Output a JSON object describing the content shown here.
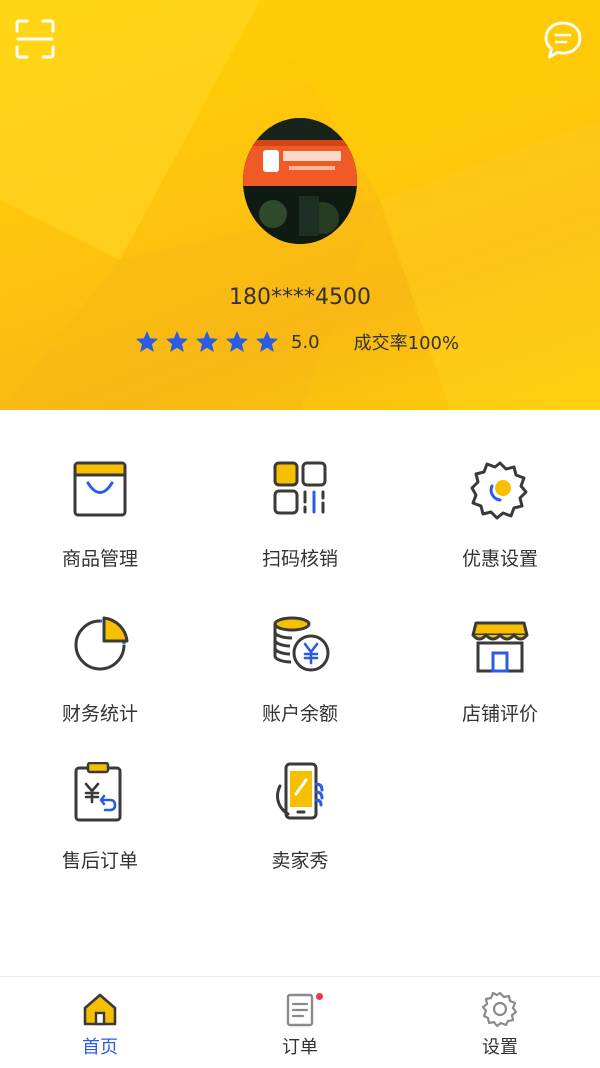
{
  "profile": {
    "phone": "180****4500",
    "rating": 5.0,
    "rating_text": "5.0",
    "deal_rate_text": "成交率100%",
    "stars": 5
  },
  "menu": [
    {
      "label": "商品管理",
      "icon": "shopping-bag-icon"
    },
    {
      "label": "扫码核销",
      "icon": "qr-scan-icon"
    },
    {
      "label": "优惠设置",
      "icon": "discount-gear-icon"
    },
    {
      "label": "财务统计",
      "icon": "pie-chart-icon"
    },
    {
      "label": "账户余额",
      "icon": "coins-yen-icon"
    },
    {
      "label": "店铺评价",
      "icon": "storefront-icon"
    },
    {
      "label": "售后订单",
      "icon": "refund-clipboard-icon"
    },
    {
      "label": "卖家秀",
      "icon": "phone-hand-icon"
    }
  ],
  "bottom_nav": [
    {
      "label": "首页",
      "icon": "home-icon",
      "active": true
    },
    {
      "label": "订单",
      "icon": "order-list-icon",
      "badge": true
    },
    {
      "label": "设置",
      "icon": "settings-gear-icon"
    }
  ],
  "colors": {
    "header_yellow": "#ffc20e",
    "accent_yellow": "#f6c000",
    "icon_dark": "#3a3a3a",
    "star_blue": "#2b5ce6",
    "active_tab": "#2b5ce6",
    "badge_red": "#f0324a"
  }
}
